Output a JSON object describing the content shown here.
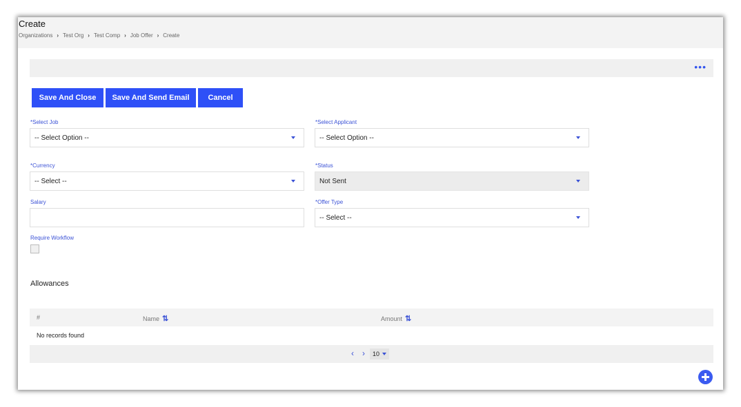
{
  "header": {
    "title": "Create",
    "breadcrumb": [
      "Organizations",
      "Test Org",
      "Test Comp",
      "Job Offer",
      "Create"
    ]
  },
  "toolbar": {
    "more_icon": "ellipsis-icon",
    "save_close_label": "Save And Close",
    "save_email_label": "Save And Send Email",
    "cancel_label": "Cancel"
  },
  "form": {
    "job": {
      "label": "*Select Job",
      "value": "-- Select Option --"
    },
    "applicant": {
      "label": "*Select Applicant",
      "value": "-- Select Option --"
    },
    "currency": {
      "label": "*Currency",
      "value": "-- Select --"
    },
    "status": {
      "label": "*Status",
      "value": "Not Sent"
    },
    "salary": {
      "label": "Salary",
      "value": ""
    },
    "offer_type": {
      "label": "*Offer Type",
      "value": "-- Select --"
    },
    "require_workflow": {
      "label": "Require Workflow",
      "checked": false
    }
  },
  "allowances": {
    "title": "Allowances",
    "columns": [
      "#",
      "Name",
      "Amount"
    ],
    "empty_text": "No records found",
    "page_size": "10"
  },
  "colors": {
    "accent": "#2e50f7",
    "label": "#3b52d6"
  }
}
